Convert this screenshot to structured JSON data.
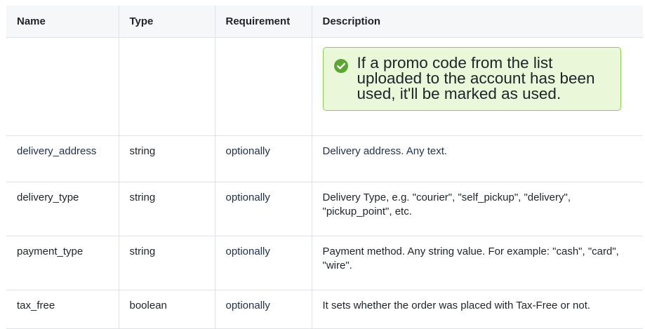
{
  "table": {
    "headers": {
      "name": "Name",
      "type": "Type",
      "requirement": "Requirement",
      "description": "Description"
    },
    "note": {
      "icon": "check-circle-icon",
      "text": "If a promo code from the list uploaded to the account has been used, it'll be marked as used.",
      "bg_color": "#eaf7d9",
      "border_color": "#8ccc57",
      "icon_color": "#5aa832"
    },
    "rows": [
      {
        "name": "delivery_address",
        "type": "string",
        "requirement": "optionally",
        "description": "Delivery address. Any text."
      },
      {
        "name": "delivery_type",
        "type": "string",
        "requirement": "optionally",
        "description": "Delivery Type, e.g. \"courier\", \"self_pickup\", \"delivery\", \"pickup_point\", etc."
      },
      {
        "name": "payment_type",
        "type": "string",
        "requirement": "optionally",
        "description": "Payment method. Any string value. For example: \"cash\", \"card\", \"wire\"."
      },
      {
        "name": "tax_free",
        "type": "boolean",
        "requirement": "optionally",
        "description": "It sets whether the order was placed with Tax-Free or not."
      }
    ]
  }
}
